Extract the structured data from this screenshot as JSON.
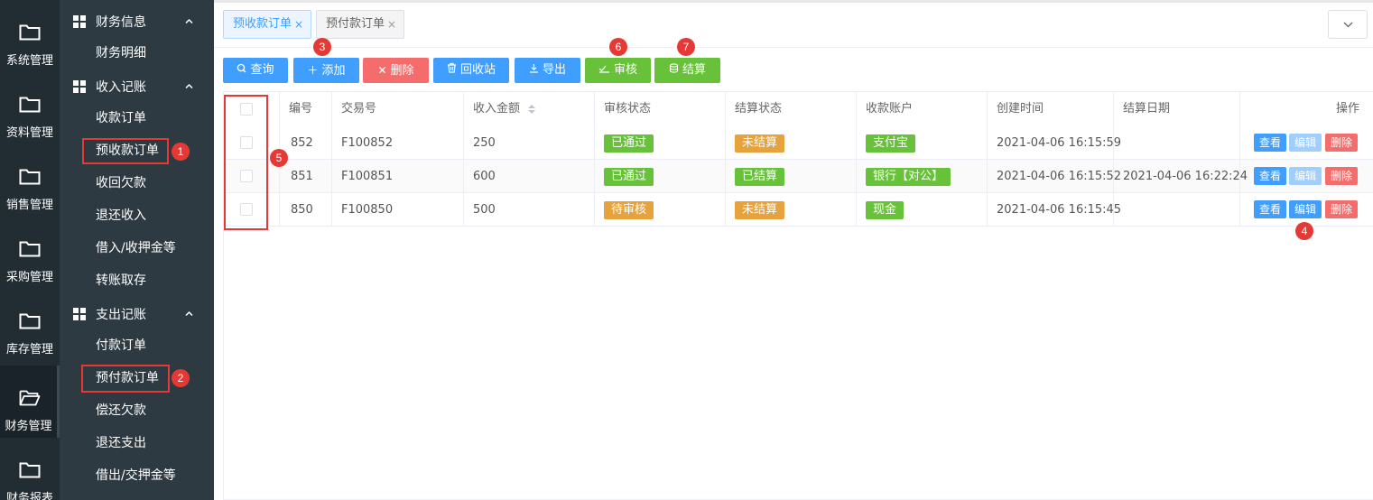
{
  "rail": [
    {
      "label": "系统管理",
      "icon": "folder-icon"
    },
    {
      "label": "资料管理",
      "icon": "folder-icon"
    },
    {
      "label": "销售管理",
      "icon": "folder-icon"
    },
    {
      "label": "采购管理",
      "icon": "folder-icon"
    },
    {
      "label": "库存管理",
      "icon": "folder-icon"
    },
    {
      "label": "财务管理",
      "icon": "folder-open-icon",
      "active": true
    },
    {
      "label": "财务报表",
      "icon": "folder-icon"
    }
  ],
  "sidebar": {
    "groups": [
      {
        "label": "财务信息",
        "items": [
          "财务明细"
        ]
      },
      {
        "label": "收入记账",
        "items": [
          "收款订单",
          "预收款订单",
          "收回欠款",
          "退还收入",
          "借入/收押金等",
          "转账取存"
        ]
      },
      {
        "label": "支出记账",
        "items": [
          "付款订单",
          "预付款订单",
          "偿还欠款",
          "退还支出",
          "借出/交押金等"
        ]
      }
    ]
  },
  "annotations": [
    "1",
    "2",
    "3",
    "4",
    "5",
    "6",
    "7"
  ],
  "tabs": [
    {
      "label": "预收款订单",
      "close": "×",
      "active": true
    },
    {
      "label": "预付款订单",
      "close": "×",
      "active": false
    }
  ],
  "toolbar": {
    "query": "查询",
    "add": "添加",
    "delete": "删除",
    "recycle": "回收站",
    "export": "导出",
    "audit": "审核",
    "settle": "结算"
  },
  "table": {
    "headers": [
      "编号",
      "交易号",
      "收入金额",
      "审核状态",
      "结算状态",
      "收款账户",
      "创建时间",
      "结算日期",
      "操作"
    ],
    "rows": [
      {
        "id": "852",
        "trade_no": "F100852",
        "amount": "250",
        "audit": "已通过",
        "audit_color": "#67c23a",
        "settle": "未结算",
        "settle_color": "#e6a23c",
        "account": "支付宝",
        "created": "2021-04-06 16:15:59",
        "settled": "",
        "edit_disabled": true
      },
      {
        "id": "851",
        "trade_no": "F100851",
        "amount": "600",
        "audit": "已通过",
        "audit_color": "#67c23a",
        "settle": "已结算",
        "settle_color": "#67c23a",
        "account": "银行【对公】",
        "created": "2021-04-06 16:15:52",
        "settled": "2021-04-06 16:22:24",
        "edit_disabled": true
      },
      {
        "id": "850",
        "trade_no": "F100850",
        "amount": "500",
        "audit": "待审核",
        "audit_color": "#e6a23c",
        "settle": "未结算",
        "settle_color": "#e6a23c",
        "account": "现金",
        "created": "2021-04-06 16:15:45",
        "settled": "",
        "edit_disabled": false
      }
    ],
    "ops": {
      "view": "查看",
      "edit": "编辑",
      "delete": "删除"
    }
  }
}
